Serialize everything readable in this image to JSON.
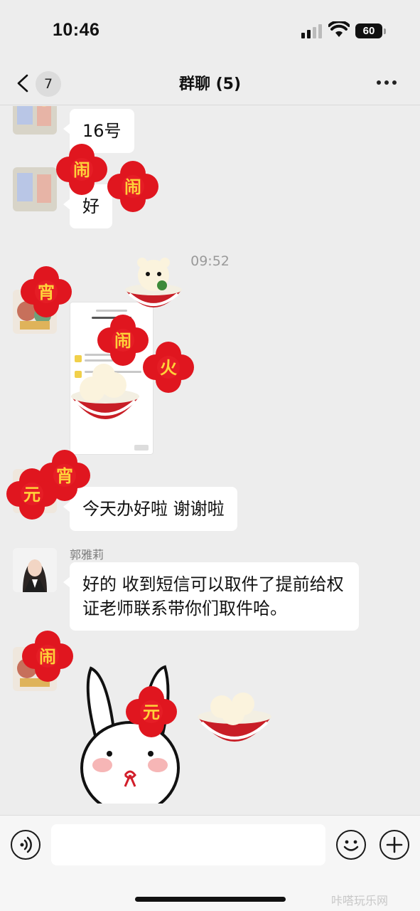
{
  "status_bar": {
    "time": "10:46",
    "battery": "60",
    "signal_icon": "signal-bars-icon",
    "wifi_icon": "wifi-icon"
  },
  "nav": {
    "back_icon": "chevron-left-icon",
    "unread_count": "7",
    "title": "群聊 (5)",
    "more_icon": "more-dots-icon"
  },
  "messages": [
    {
      "type": "text",
      "text": "16号"
    },
    {
      "type": "text",
      "text": "好"
    },
    {
      "type": "time",
      "text": "09:52"
    },
    {
      "type": "image",
      "content": "screenshot-thumbnail"
    },
    {
      "type": "text",
      "text": "今天办好啦 谢谢啦"
    },
    {
      "type": "text",
      "sender": "郭雅莉",
      "text": "好的 收到短信可以取件了提前给权证老师联系带你们取件哈。"
    },
    {
      "type": "sticker",
      "content": "rabbit-sticker"
    }
  ],
  "stickers": [
    "闹",
    "闹",
    "宵",
    "闹",
    "火",
    "宵",
    "元",
    "闹",
    "元"
  ],
  "input": {
    "voice_icon": "voice-input-icon",
    "placeholder": "",
    "emoji_icon": "emoji-icon",
    "plus_icon": "plus-icon"
  },
  "watermark": "咔嗒玩乐网",
  "colors": {
    "background": "#ededed",
    "bubble": "#ffffff",
    "flower_red": "#e0161f",
    "flower_text": "#ffd23a"
  }
}
